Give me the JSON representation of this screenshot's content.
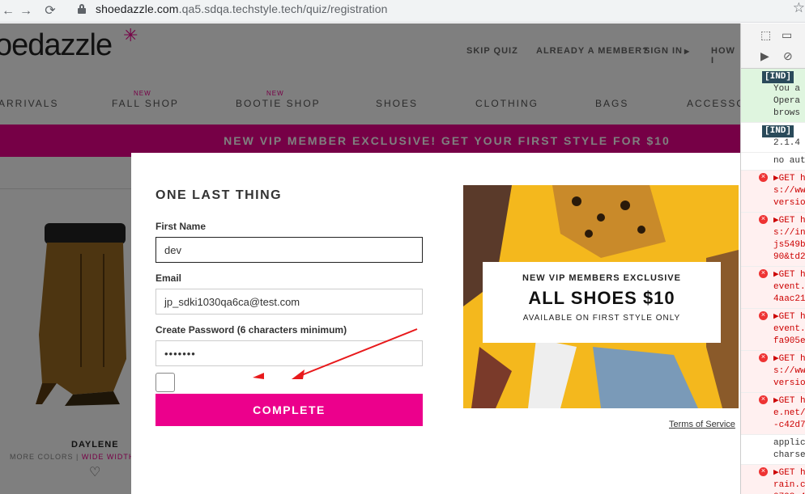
{
  "browser": {
    "url_host": "shoedazzle.com",
    "url_path": ".qa5.sdqa.techstyle.tech/quiz/registration"
  },
  "header": {
    "logo": "oedazzle",
    "skip_quiz": "SKIP QUIZ",
    "already_member": "ALREADY A MEMBER?",
    "sign_in": "SIGN IN",
    "how": "HOW I",
    "new_tag": "NEW",
    "nav": [
      "ARRIVALS",
      "FALL SHOP",
      "BOOTIE SHOP",
      "SHOES",
      "CLOTHING",
      "BAGS",
      "ACCESSO"
    ]
  },
  "banner": "NEW VIP MEMBER EXCLUSIVE! GET YOUR FIRST STYLE FOR $10",
  "product": {
    "name": "DAYLENE",
    "more_colors": "MORE COLORS",
    "separator": "|",
    "wide_width": "WIDE WIDTH"
  },
  "modal": {
    "title": "ONE LAST THING",
    "first_name_label": "First Name",
    "first_name_value": "dev",
    "email_label": "Email",
    "email_value": "jp_sdki1030qa6ca@test.com",
    "password_label": "Create Password (6 characters minimum)",
    "password_value": "•••••••",
    "submit": "COMPLETE",
    "terms": "Terms of Service"
  },
  "promo": {
    "line1": "NEW VIP MEMBERS EXCLUSIVE",
    "line2": "ALL SHOES $10",
    "line3": "AVAILABLE ON FIRST STYLE ONLY"
  },
  "devtools": {
    "messages": [
      {
        "type": "info",
        "tag": "[IND]",
        "lines": [
          "You a",
          "Opera",
          "brows"
        ]
      },
      {
        "type": "info",
        "tag": "[IND]",
        "lines": [
          "2.1.4"
        ]
      },
      {
        "type": "log",
        "lines": [
          "no aut"
        ]
      },
      {
        "type": "error",
        "lines": [
          "▶GET h",
          "s://www",
          "versio"
        ]
      },
      {
        "type": "error",
        "lines": [
          "▶GET h",
          "s://in",
          "js549b",
          "90&td2"
        ]
      },
      {
        "type": "error",
        "lines": [
          "▶GET h",
          "event.",
          "4aac21"
        ]
      },
      {
        "type": "error",
        "lines": [
          "▶GET h",
          "event.",
          "fa905e"
        ]
      },
      {
        "type": "error",
        "lines": [
          "▶GET h",
          "s://www",
          "versio"
        ]
      },
      {
        "type": "error",
        "lines": [
          "▶GET h",
          "e.net/",
          "-c42d7"
        ]
      },
      {
        "type": "log",
        "lines": [
          "applic",
          "charse"
        ]
      },
      {
        "type": "error",
        "lines": [
          "▶GET h",
          "rain.c",
          "0798-4"
        ]
      }
    ]
  },
  "colors": {
    "brand_pink": "#ec008c",
    "promo_yellow": "#f4b81d",
    "arrow_red": "#e8191b"
  }
}
